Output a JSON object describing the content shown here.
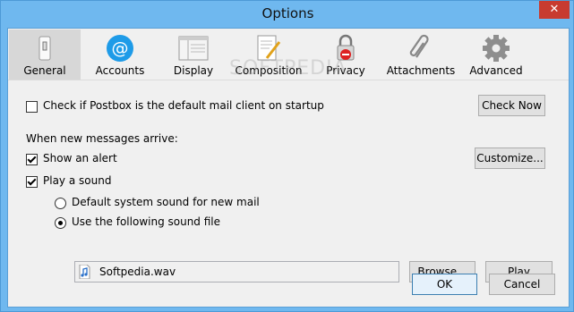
{
  "window": {
    "title": "Options",
    "close_glyph": "✕"
  },
  "toolbar": {
    "tabs": [
      {
        "label": "General",
        "icon": "switch-icon",
        "selected": true
      },
      {
        "label": "Accounts",
        "icon": "at-sign-icon",
        "selected": false
      },
      {
        "label": "Display",
        "icon": "window-layout-icon",
        "selected": false
      },
      {
        "label": "Composition",
        "icon": "pen-paper-icon",
        "selected": false
      },
      {
        "label": "Privacy",
        "icon": "lock-icon",
        "selected": false
      },
      {
        "label": "Attachments",
        "icon": "paperclip-icon",
        "selected": false
      },
      {
        "label": "Advanced",
        "icon": "gear-icon",
        "selected": false
      }
    ]
  },
  "general": {
    "default_client_label": "Check if Postbox is the default mail client on startup",
    "default_client_checked": false,
    "check_now_label": "Check Now",
    "new_messages_label": "When new messages arrive:",
    "show_alert_label": "Show an alert",
    "show_alert_checked": true,
    "customize_label": "Customize...",
    "play_sound_label": "Play a sound",
    "play_sound_checked": true,
    "default_sound_label": "Default system sound for new mail",
    "use_file_label": "Use the following sound file",
    "selected_sound_option": "file",
    "sound_file": "Softpedia.wav",
    "browse_label": "Browse...",
    "play_label": "Play"
  },
  "footer": {
    "ok_label": "OK",
    "cancel_label": "Cancel"
  },
  "watermark": "SOFTPEDIA",
  "colors": {
    "titlebar": "#6fb8ef",
    "accounts_icon": "#1e9be8",
    "close": "#c83b30"
  }
}
